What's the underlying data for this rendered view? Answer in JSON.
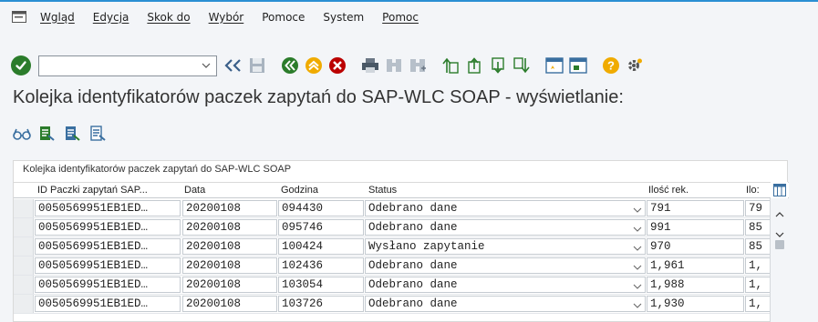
{
  "menubar": {
    "items": [
      "Wgląd",
      "Edycja",
      "Skok do",
      "Wybór",
      "Pomoce",
      "System",
      "Pomoc"
    ]
  },
  "toolbar": {
    "command_value": "",
    "icons": [
      "ok-icon",
      "back-icon",
      "save-icon",
      "back-nav-icon",
      "exit-icon",
      "cancel-icon",
      "print-icon",
      "find-icon",
      "find-next-icon",
      "first-page-icon",
      "prev-page-icon",
      "next-page-icon",
      "last-page-icon",
      "new-session-icon",
      "shortcut-icon",
      "help-icon",
      "settings-icon"
    ]
  },
  "page": {
    "title": "Kolejka identyfikatorów paczek zapytań do SAP-WLC SOAP - wyświetlanie:"
  },
  "panel": {
    "title": "Kolejka identyfikatorów paczek zapytań do SAP-WLC SOAP"
  },
  "table": {
    "headers": [
      "ID Paczki zapytań SAP...",
      "Data",
      "Godzina",
      "Status",
      "Ilość rek.",
      "Ilo:"
    ],
    "rows": [
      {
        "id": "0050569951EB1ED…",
        "date": "20200108",
        "time": "094430",
        "status": "Odebrano dane",
        "qty": "791",
        "qty2": "79"
      },
      {
        "id": "0050569951EB1ED…",
        "date": "20200108",
        "time": "095746",
        "status": "Odebrano dane",
        "qty": "991",
        "qty2": "85"
      },
      {
        "id": "0050569951EB1ED…",
        "date": "20200108",
        "time": "100424",
        "status": "Wysłano zapytanie",
        "qty": "970",
        "qty2": "85"
      },
      {
        "id": "0050569951EB1ED…",
        "date": "20200108",
        "time": "102436",
        "status": "Odebrano dane",
        "qty": "1,961",
        "qty2": "1,"
      },
      {
        "id": "0050569951EB1ED…",
        "date": "20200108",
        "time": "103054",
        "status": "Odebrano dane",
        "qty": "1,988",
        "qty2": "1,"
      },
      {
        "id": "0050569951EB1ED…",
        "date": "20200108",
        "time": "103726",
        "status": "Odebrano dane",
        "qty": "1,930",
        "qty2": "1,"
      }
    ]
  },
  "colors": {
    "accent": "#2a8fd3",
    "ok_green": "#2b7c2b",
    "nav_green": "#2b7c2b",
    "nav_orange": "#f0ab00",
    "nav_red": "#bb0000",
    "help_yellow": "#f0ab00"
  }
}
